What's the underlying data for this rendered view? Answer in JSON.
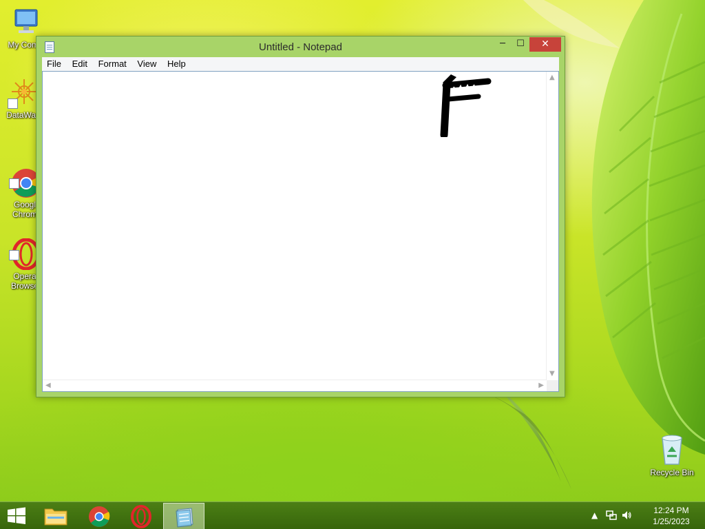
{
  "colors": {
    "titlebar": "#a8d468",
    "close_button": "#c7433a",
    "taskbar": "#4b7f15"
  },
  "desktop": {
    "icons": [
      {
        "label": "My Comp",
        "icon": "computer-icon"
      },
      {
        "label": "DataWag",
        "icon": "datawag-icon"
      },
      {
        "label": "Googl\nChrom",
        "icon": "chrome-icon"
      },
      {
        "label": "Opera\nBrowse",
        "icon": "opera-icon"
      }
    ],
    "recycle_bin": {
      "label": "Recycle Bin",
      "icon": "recycle-bin-icon"
    }
  },
  "window": {
    "title": "Untitled - Notepad",
    "icon": "notepad-icon",
    "menu": [
      "File",
      "Edit",
      "Format",
      "View",
      "Help"
    ],
    "minimize_glyph": "─",
    "maximize_glyph": "☐",
    "close_glyph": "✕",
    "content": ""
  },
  "taskbar": {
    "items": [
      {
        "name": "file-explorer",
        "icon": "folder-icon"
      },
      {
        "name": "google-chrome",
        "icon": "chrome-icon"
      },
      {
        "name": "opera",
        "icon": "opera-icon"
      },
      {
        "name": "notepad",
        "icon": "notepad-icon",
        "active": true
      }
    ],
    "tray": {
      "show_hidden_glyph": "▲",
      "time": "12:24 PM",
      "date": "1/25/2023"
    }
  }
}
